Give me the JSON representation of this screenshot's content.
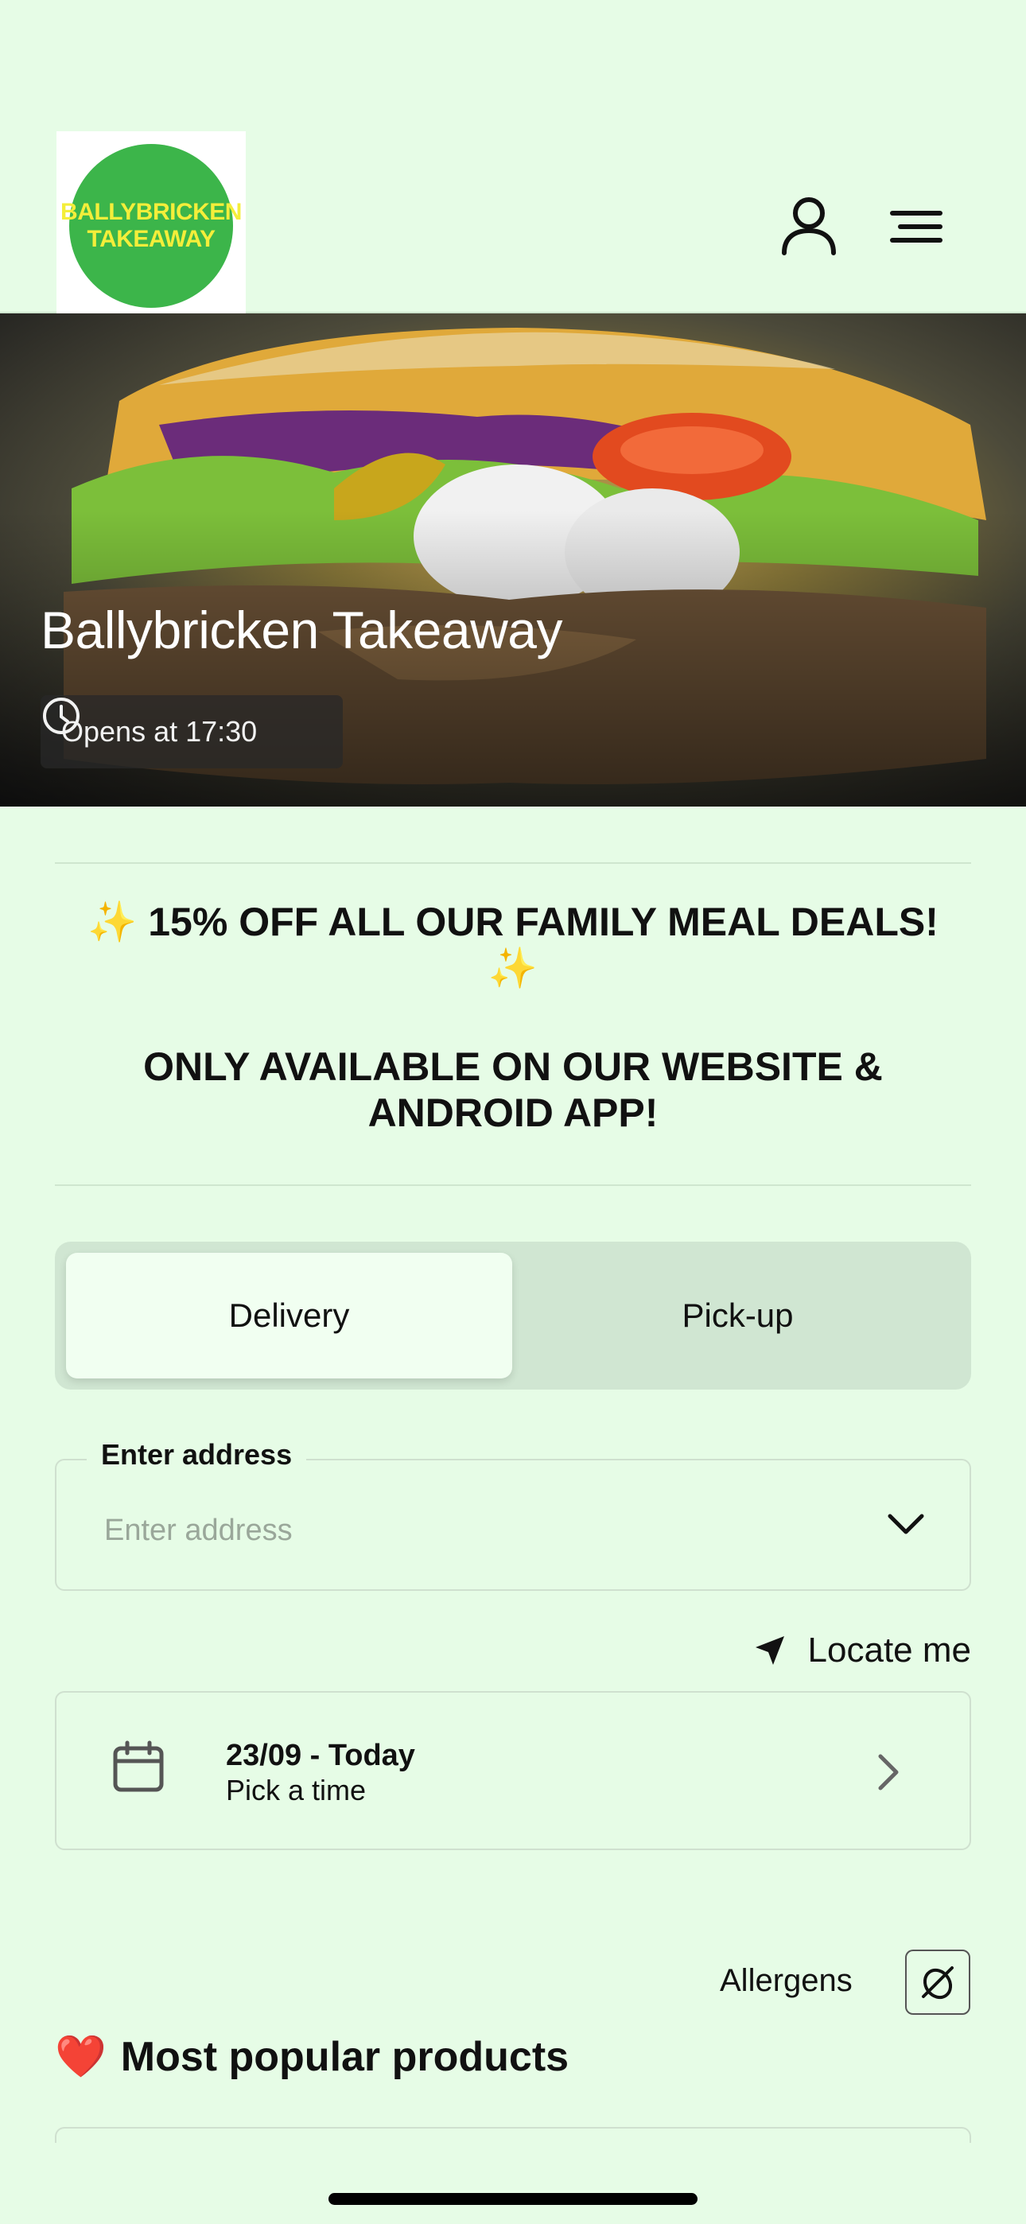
{
  "header": {
    "logo_line1": "BALLYBRICKEN",
    "logo_line2": "TAKEAWAY",
    "logo_circle_color": "#3cb54a",
    "logo_text_color": "#f4ee3a",
    "account_icon": "user-icon",
    "menu_icon": "hamburger-menu-icon"
  },
  "hero": {
    "title": "Ballybricken Takeaway",
    "opens_text": "Opens at 17:30",
    "clock_icon": "clock-icon"
  },
  "promo": {
    "line1_prefix": "✨ ",
    "line1_text": "15% OFF ALL OUR FAMILY MEAL DEALS!",
    "line1_suffix": "✨",
    "line2": "ONLY AVAILABLE ON OUR WEBSITE & ANDROID APP!"
  },
  "order_type": {
    "options": [
      "Delivery",
      "Pick-up"
    ],
    "selected": "Delivery"
  },
  "address": {
    "label": "Enter address",
    "placeholder": "Enter address",
    "value": ""
  },
  "locate": {
    "label": "Locate me",
    "icon": "location-arrow-icon"
  },
  "schedule": {
    "date_label": "23/09 - Today",
    "time_label": "Pick a time",
    "icon": "calendar-icon"
  },
  "allergens": {
    "label": "Allergens",
    "icon": "allergen-icon"
  },
  "popular": {
    "emoji": "❤️",
    "title": "Most popular products"
  },
  "colors": {
    "background": "#e6fce6",
    "toggle_bg": "#d0e6d2",
    "toggle_active": "#f1fff1"
  }
}
